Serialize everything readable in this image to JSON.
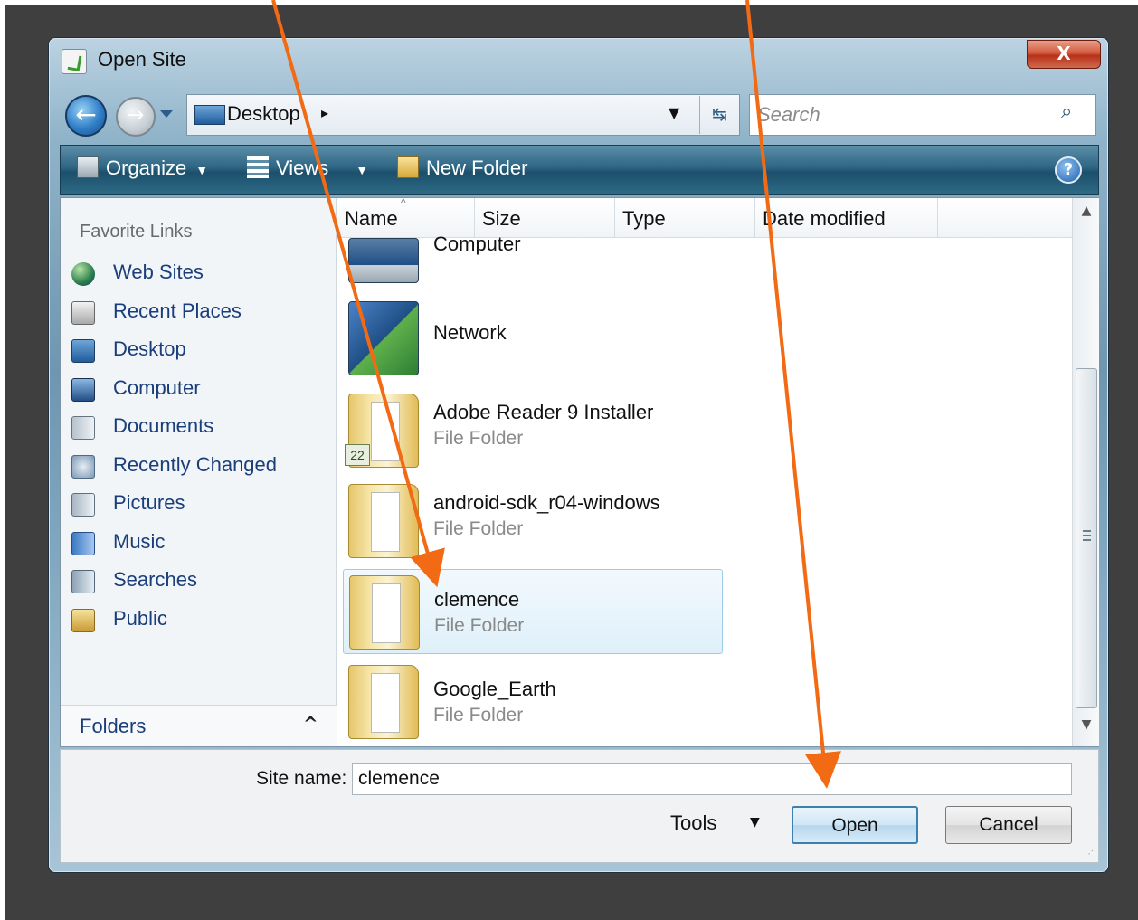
{
  "window": {
    "title": "Open Site",
    "close_label": "X"
  },
  "nav": {
    "back_label": "←",
    "forward_label": "→",
    "address": "Desktop",
    "address_chevron": "▸",
    "address_dropdown": "▼",
    "refresh_label": "↹"
  },
  "search": {
    "placeholder": "Search",
    "icon": "⌕"
  },
  "toolbar": {
    "organize_label": "Organize",
    "views_label": "Views",
    "new_folder_label": "New Folder",
    "caret": "▼",
    "help_label": "?"
  },
  "sidebar": {
    "header": "Favorite Links",
    "items": [
      {
        "label": "Web Sites",
        "icon": "globe-icon"
      },
      {
        "label": "Recent Places",
        "icon": "recent-places-icon"
      },
      {
        "label": "Desktop",
        "icon": "desktop-icon"
      },
      {
        "label": "Computer",
        "icon": "computer-icon"
      },
      {
        "label": "Documents",
        "icon": "documents-icon"
      },
      {
        "label": "Recently Changed",
        "icon": "recently-changed-icon"
      },
      {
        "label": "Pictures",
        "icon": "pictures-icon"
      },
      {
        "label": "Music",
        "icon": "music-icon"
      },
      {
        "label": "Searches",
        "icon": "searches-icon"
      },
      {
        "label": "Public",
        "icon": "public-folder-icon"
      }
    ],
    "folders_label": "Folders",
    "folders_chevron": "^"
  },
  "columns": [
    "Name",
    "Size",
    "Type",
    "Date modified"
  ],
  "sort_indicator": "^",
  "files": [
    {
      "name": "Computer",
      "type": "",
      "icon": "computer-icon"
    },
    {
      "name": "Network",
      "type": "",
      "icon": "network-icon"
    },
    {
      "name": "Adobe Reader 9 Installer",
      "type": "File Folder",
      "icon": "folder-icon",
      "badge": "22"
    },
    {
      "name": "android-sdk_r04-windows",
      "type": "File Folder",
      "icon": "folder-icon"
    },
    {
      "name": "clemence",
      "type": "File Folder",
      "icon": "folder-icon",
      "selected": true
    },
    {
      "name": "Google_Earth",
      "type": "File Folder",
      "icon": "folder-icon"
    }
  ],
  "scrollbar": {
    "up": "▲",
    "down": "▼"
  },
  "bottom": {
    "site_name_label": "Site name:",
    "site_name_value": "clemence",
    "tools_label": "Tools",
    "tools_caret": "▼",
    "open_label": "Open",
    "cancel_label": "Cancel",
    "grip": "⋰"
  },
  "colors": {
    "annotation_arrow": "#f26a13",
    "toolbar": "#2d6583",
    "selection": "#dff0fa"
  }
}
